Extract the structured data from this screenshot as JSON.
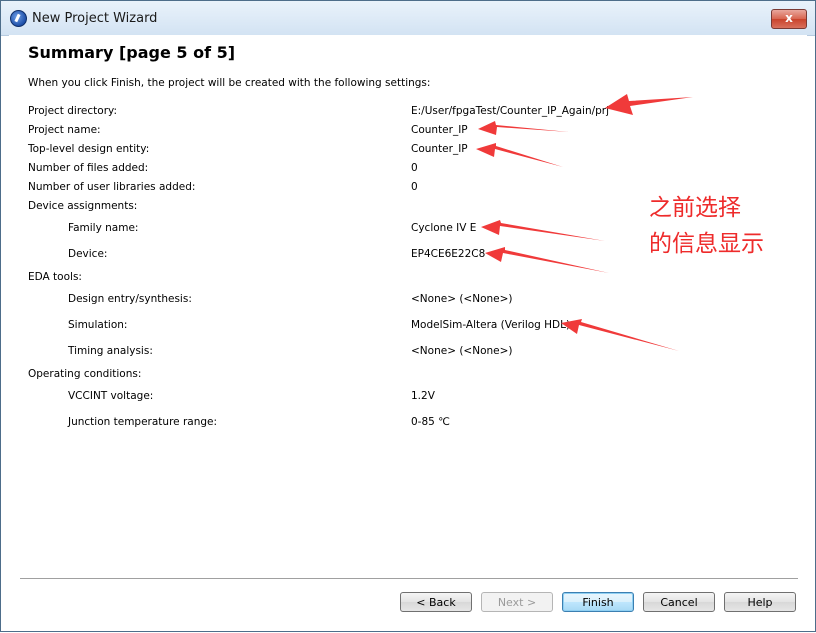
{
  "window": {
    "title": "New Project Wizard",
    "close_glyph": "x",
    "app_icon": "quartus-icon"
  },
  "page": {
    "heading": "Summary [page 5 of 5]",
    "intro": "When you click Finish, the project will be created with the following settings:"
  },
  "settings": [
    {
      "label": "Project directory:",
      "value": "E:/User/fpgaTest/Counter_IP_Again/prj"
    },
    {
      "label": "Project name:",
      "value": "Counter_IP"
    },
    {
      "label": "Top-level design entity:",
      "value": "Counter_IP"
    },
    {
      "label": "Number of files added:",
      "value": "0"
    },
    {
      "label": "Number of user libraries added:",
      "value": "0"
    },
    {
      "label": "Device assignments:",
      "value": ""
    },
    {
      "label": "Family name:",
      "value": "Cyclone IV E"
    },
    {
      "label": "Device:",
      "value": "EP4CE6E22C8"
    },
    {
      "label": "EDA tools:",
      "value": ""
    },
    {
      "label": "Design entry/synthesis:",
      "value": "<None> (<None>)"
    },
    {
      "label": "Simulation:",
      "value": "ModelSim-Altera (Verilog HDL)"
    },
    {
      "label": "Timing analysis:",
      "value": "<None> (<None>)"
    },
    {
      "label": "Operating conditions:",
      "value": ""
    },
    {
      "label": "VCCINT voltage:",
      "value": "1.2V"
    },
    {
      "label": "Junction temperature range:",
      "value": "0-85 ℃"
    }
  ],
  "annotation": {
    "line1": "之前选择",
    "line2": "的信息显示",
    "color": "#ee2b2b"
  },
  "buttons": {
    "back": "< Back",
    "next": "Next >",
    "finish": "Finish",
    "cancel": "Cancel",
    "help": "Help"
  }
}
